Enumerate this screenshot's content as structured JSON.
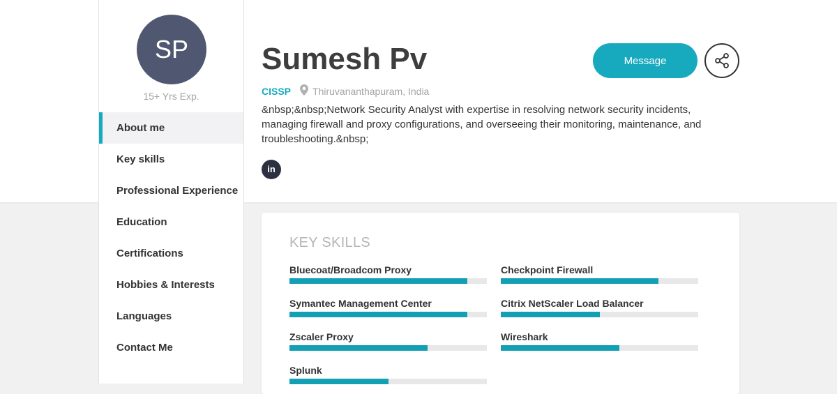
{
  "profile": {
    "initials": "SP",
    "experience": "15+ Yrs Exp.",
    "name": "Sumesh Pv",
    "certification": "CISSP",
    "location": "Thiruvananthapuram, India",
    "bio": "&nbsp;&nbsp;Network Security Analyst with expertise in resolving network security incidents, managing firewall and proxy configurations, and overseeing their monitoring, maintenance, and troubleshooting.&nbsp;",
    "linkedin_label": "in"
  },
  "actions": {
    "message_label": "Message",
    "share_icon": "share-icon"
  },
  "sidebar": {
    "items": [
      {
        "label": "About me",
        "active": true
      },
      {
        "label": "Key skills"
      },
      {
        "label": "Professional Experience"
      },
      {
        "label": "Education"
      },
      {
        "label": "Certifications"
      },
      {
        "label": "Hobbies & Interests"
      },
      {
        "label": "Languages"
      },
      {
        "label": "Contact Me"
      }
    ]
  },
  "skills": {
    "title": "KEY SKILLS",
    "items": [
      {
        "name": "Bluecoat/Broadcom Proxy",
        "level": 0.9
      },
      {
        "name": "Checkpoint Firewall",
        "level": 0.8
      },
      {
        "name": "Symantec Management Center",
        "level": 0.9
      },
      {
        "name": "Citrix NetScaler Load Balancer",
        "level": 0.5
      },
      {
        "name": "Zscaler Proxy",
        "level": 0.7
      },
      {
        "name": "Wireshark",
        "level": 0.6
      },
      {
        "name": "Splunk",
        "level": 0.5
      }
    ]
  },
  "colors": {
    "accent": "#17aabf",
    "avatar": "#4f5870",
    "bar": "#14a0b4"
  }
}
